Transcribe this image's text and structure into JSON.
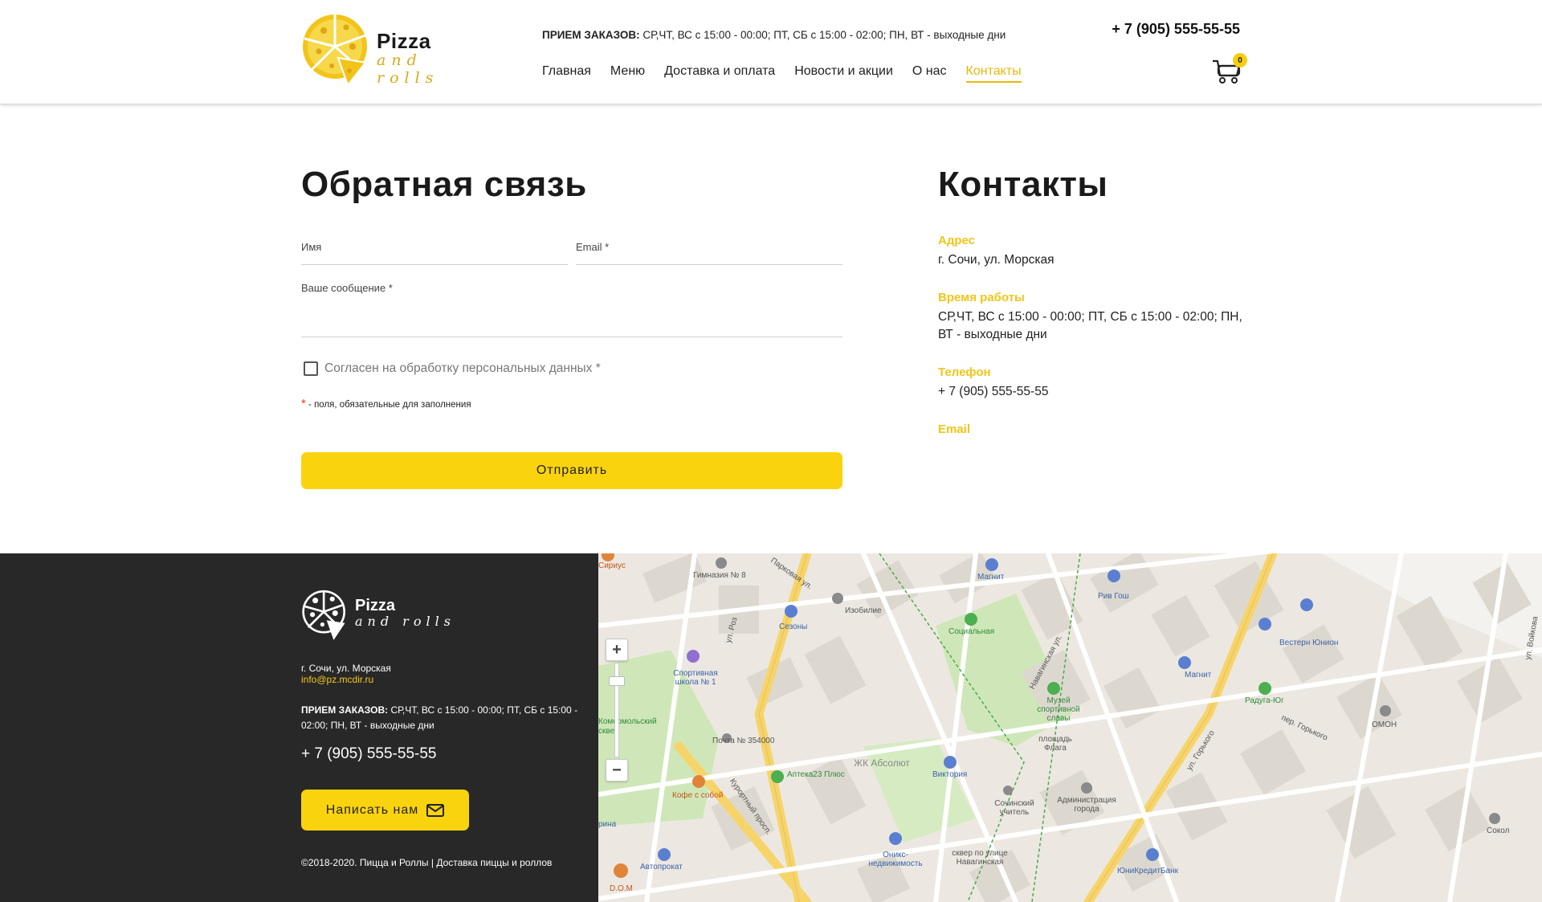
{
  "header": {
    "logo_top": "Pizza",
    "logo_bottom": "and rolls",
    "hours_label": "ПРИЕМ ЗАКАЗОВ:",
    "hours_value": "СР,ЧТ, ВС с 15:00 - 00:00; ПТ, СБ с 15:00 - 02:00; ПН, ВТ - выходные дни",
    "phone": "+ 7 (905) 555-55-55",
    "cart_count": "0",
    "nav": [
      {
        "label": "Главная"
      },
      {
        "label": "Меню"
      },
      {
        "label": "Доставка и оплата"
      },
      {
        "label": "Новости и акции"
      },
      {
        "label": "О нас"
      },
      {
        "label": "Контакты",
        "active": true
      }
    ]
  },
  "feedback": {
    "title": "Обратная связь",
    "name_label": "Имя",
    "email_label": "Email *",
    "message_label": "Ваше сообщение *",
    "agree_label": "Согласен на обработку персональных данных *",
    "required_star": "*",
    "required_note": "- поля, обязательные для заполнения",
    "submit_label": "Отправить"
  },
  "contacts": {
    "title": "Контакты",
    "address_label": "Адрес",
    "address_value": "г. Сочи, ул. Морская",
    "hours_label": "Время работы",
    "hours_value": "СР,ЧТ, ВС с 15:00 - 00:00; ПТ, СБ с 15:00 - 02:00; ПН, ВТ - выходные дни",
    "phone_label": "Телефон",
    "phone_value": "+ 7 (905) 555-55-55",
    "email_label": "Email"
  },
  "footer": {
    "logo_top": "Pizza",
    "logo_bottom": "and rolls",
    "address": "г. Сочи, ул. Морская",
    "email": "info@pz.mcdir.ru",
    "hours_label": "ПРИЕМ ЗАКАЗОВ:",
    "hours_value": "СР,ЧТ, ВС с 15:00 - 00:00; ПТ, СБ с 15:00 - 02:00; ПН, ВТ - выходные дни",
    "phone": "+ 7 (905) 555-55-55",
    "write_label": "Написать нам",
    "copyright": "©2018-2020. Пицца и Роллы | Доставка пиццы и роллов"
  },
  "map": {
    "zoom_in": "+",
    "zoom_out": "−",
    "labels": [
      {
        "text": "Гимназия № 8",
        "kind": "plain"
      },
      {
        "text": "Парковая ул.",
        "kind": "plain"
      },
      {
        "text": "Изобилие",
        "kind": "plain"
      },
      {
        "text": "Сезоны",
        "kind": "poi"
      },
      {
        "text": "Магнит",
        "kind": "poi"
      },
      {
        "text": "Рив Гош",
        "kind": "poi"
      },
      {
        "text": "Социальная",
        "kind": "green"
      },
      {
        "text": "Вестерн Юнион",
        "kind": "poi"
      },
      {
        "text": "ул. Войкова",
        "kind": "plain"
      },
      {
        "text": "Спортивная школа № 1",
        "kind": "poi"
      },
      {
        "text": "Навагинская ул.",
        "kind": "plain"
      },
      {
        "text": "Музей спортивной славы",
        "kind": "green"
      },
      {
        "text": "Магнит",
        "kind": "poi"
      },
      {
        "text": "Радуга-Юг",
        "kind": "green"
      },
      {
        "text": "ОМОН",
        "kind": "plain"
      },
      {
        "text": "Почта № 354000",
        "kind": "plain"
      },
      {
        "text": "площадь Флага",
        "kind": "plain"
      },
      {
        "text": "пер. Горького",
        "kind": "plain"
      },
      {
        "text": "Аптека23 Плюс",
        "kind": "green"
      },
      {
        "text": "ЖК Абсолют",
        "kind": "plain"
      },
      {
        "text": "Виктория",
        "kind": "poi"
      },
      {
        "text": "ул. Горького",
        "kind": "plain"
      },
      {
        "text": "Кофе с собой",
        "kind": "orange"
      },
      {
        "text": "Курортный просп.",
        "kind": "plain"
      },
      {
        "text": "Сочинский учитель",
        "kind": "plain"
      },
      {
        "text": "Администрация города",
        "kind": "plain"
      },
      {
        "text": "Оникс-недвижимость",
        "kind": "poi"
      },
      {
        "text": "сквер по улице Навагинская",
        "kind": "plain"
      },
      {
        "text": "ЮниКредитБанк",
        "kind": "poi"
      },
      {
        "text": "Автопрокат",
        "kind": "poi"
      },
      {
        "text": "D.O.M",
        "kind": "orange"
      },
      {
        "text": "Сокол",
        "kind": "plain"
      },
      {
        "text": "Сириус",
        "kind": "orange"
      },
      {
        "text": "Комсомольский сквер",
        "kind": "green"
      },
      {
        "text": "рина",
        "kind": "poi"
      },
      {
        "text": "ул. Роз",
        "kind": "plain"
      }
    ]
  }
}
